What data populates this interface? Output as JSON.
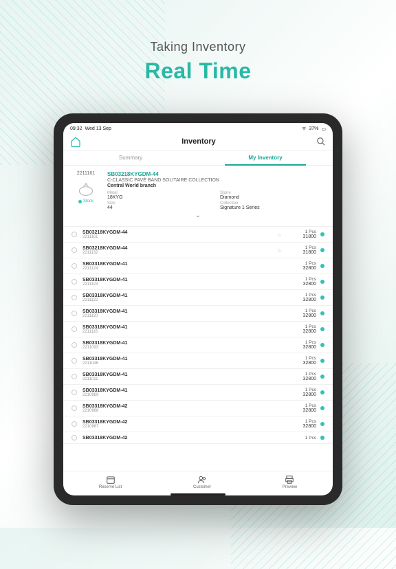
{
  "headline": {
    "line1": "Taking Inventory",
    "line2": "Real Time"
  },
  "statusbar": {
    "time": "09:32",
    "date": "Wed 13 Sep",
    "battery": "37%"
  },
  "navbar": {
    "title": "Inventory"
  },
  "tabs": {
    "summary": "Summary",
    "myinventory": "My Inventory"
  },
  "detail": {
    "id": "2211161",
    "sku": "SB03218KYGDM-44",
    "collection_name": "C-CLASSIC PAVÉ BAND SOLITAIRE COLLECTION",
    "branch": "Central World branch",
    "metal_label": "Metal",
    "metal_value": "18KYG",
    "size_label": "Size",
    "size_value": "44",
    "stone_label": "Stone",
    "stone_value": "Diamond",
    "coll_label": "Collection",
    "coll_value": "Signature 1 Series",
    "stock_label": "Stock"
  },
  "rows": [
    {
      "sku": "SB03218KYGDM-44",
      "id": "2211161",
      "pcs": "1 Pcs",
      "price": "31800",
      "flag": true
    },
    {
      "sku": "SB03218KYGDM-44",
      "id": "2211132",
      "pcs": "1 Pcs",
      "price": "31800",
      "flag": true
    },
    {
      "sku": "SB03318KYGDM-41",
      "id": "2211124",
      "pcs": "1 Pcs",
      "price": "32800",
      "flag": false
    },
    {
      "sku": "SB03318KYGDM-41",
      "id": "2211123",
      "pcs": "1 Pcs",
      "price": "32800",
      "flag": false
    },
    {
      "sku": "SB03318KYGDM-41",
      "id": "2211122",
      "pcs": "1 Pcs",
      "price": "32800",
      "flag": false
    },
    {
      "sku": "SB03318KYGDM-41",
      "id": "2211120",
      "pcs": "1 Pcs",
      "price": "32800",
      "flag": false
    },
    {
      "sku": "SB03318KYGDM-41",
      "id": "2211116",
      "pcs": "1 Pcs",
      "price": "32800",
      "flag": false
    },
    {
      "sku": "SB03318KYGDM-41",
      "id": "2211093",
      "pcs": "1 Pcs",
      "price": "32800",
      "flag": false
    },
    {
      "sku": "SB03318KYGDM-41",
      "id": "2211046",
      "pcs": "1 Pcs",
      "price": "32800",
      "flag": false
    },
    {
      "sku": "SB03318KYGDM-41",
      "id": "2211011",
      "pcs": "1 Pcs",
      "price": "32800",
      "flag": false
    },
    {
      "sku": "SB03318KYGDM-41",
      "id": "2210989",
      "pcs": "1 Pcs",
      "price": "32800",
      "flag": false
    },
    {
      "sku": "SB03318KYGDM-42",
      "id": "2210968",
      "pcs": "1 Pcs",
      "price": "32800",
      "flag": false
    },
    {
      "sku": "SB03318KYGDM-42",
      "id": "2210967",
      "pcs": "1 Pcs",
      "price": "32800",
      "flag": false
    },
    {
      "sku": "SB03318KYGDM-42",
      "id": "",
      "pcs": "1 Pcs",
      "price": "",
      "flag": false
    }
  ],
  "bottom": {
    "reserve": "Reserve List",
    "customer": "Customer",
    "preview": "Preview"
  }
}
